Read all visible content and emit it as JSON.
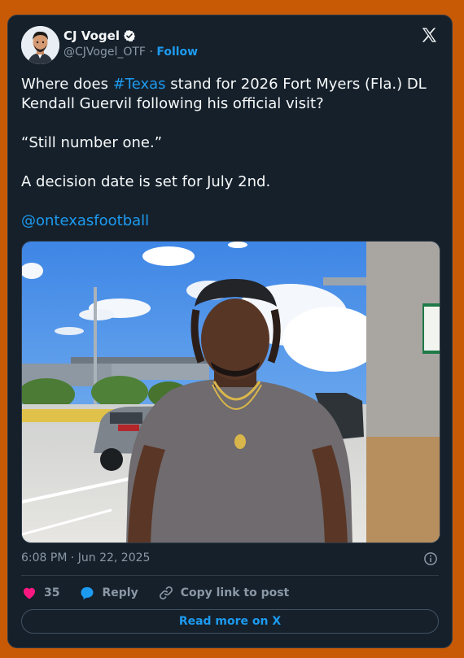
{
  "author": {
    "name": "CJ Vogel",
    "handle": "@CJVogel_OTF",
    "separator": "·",
    "follow_label": "Follow"
  },
  "post": {
    "line1_pre": "Where does ",
    "hashtag": "#Texas",
    "line1_post": " stand for 2026 Fort Myers (Fla.) DL Kendall Guervil following his official visit?",
    "quote": "“Still number one.”",
    "decision": "A decision date is set for July 2nd.",
    "mention": "@ontexasfootball"
  },
  "timestamp": "6:08 PM · Jun 22, 2025",
  "actions": {
    "likes": "35",
    "reply_label": "Reply",
    "copy_label": "Copy link to post"
  },
  "read_more_label": "Read more on X",
  "icons": [
    "verified-badge-icon",
    "x-logo-icon",
    "info-icon",
    "heart-icon",
    "reply-bubble-icon",
    "link-icon"
  ],
  "colors": {
    "accent": "#1d9bf0",
    "background": "#15202b",
    "page": "#c85a06",
    "heart": "#f91880"
  }
}
